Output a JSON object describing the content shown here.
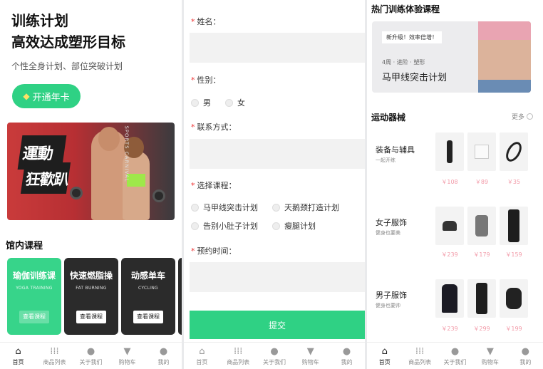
{
  "screen1": {
    "title_line1": "训练计划",
    "title_line2": "高效达成塑形目标",
    "subtitle": "个性全身计划、部位突破计划",
    "vip_button": "开通年卡",
    "banner_text1": "運動",
    "banner_text2": "狂歡趴",
    "banner_side": "SPORTS CARNIVAL",
    "section_title": "馆内课程",
    "courses": [
      {
        "name": "瑜伽训练课",
        "en": "YOGA TRAINING",
        "button": "查看课程"
      },
      {
        "name": "快速燃脂操",
        "en": "FAT BURNING",
        "button": "查看课程"
      },
      {
        "name": "动感单车",
        "en": "CYCLING",
        "button": "查看课程"
      }
    ]
  },
  "tabs": [
    "首页",
    "商品列表",
    "关于我们",
    "购物车",
    "我的"
  ],
  "screen2": {
    "name_label": "姓名：",
    "gender_label": "性别：",
    "gender_options": [
      "男",
      "女"
    ],
    "contact_label": "联系方式：",
    "course_label": "选择课程：",
    "course_options": [
      "马甲线突击计划",
      "天鹅颈打造计划",
      "告别小肚子计划",
      "瘦腿计划"
    ],
    "time_label": "预约时间：",
    "submit": "提交"
  },
  "screen3": {
    "hot_title": "热门训练体验课程",
    "promo_tag": "新升级！效率倍增！",
    "promo_small": "4周 · 进阶 · 塑形",
    "promo_big": "马甲线突击计划",
    "equip_title": "运动器械",
    "more": "更多",
    "categories": [
      {
        "name": "装备与辅具",
        "sub": "一起开练",
        "prices": [
          "￥108",
          "￥89",
          "￥35"
        ]
      },
      {
        "name": "女子服饰",
        "sub": "健身也要美",
        "prices": [
          "￥239",
          "￥179",
          "￥159"
        ]
      },
      {
        "name": "男子服饰",
        "sub": "健身也要帅",
        "prices": [
          "￥239",
          "￥299",
          "￥199"
        ]
      }
    ]
  },
  "colors": {
    "accent": "#2fd184",
    "price": "#f29aa8"
  }
}
